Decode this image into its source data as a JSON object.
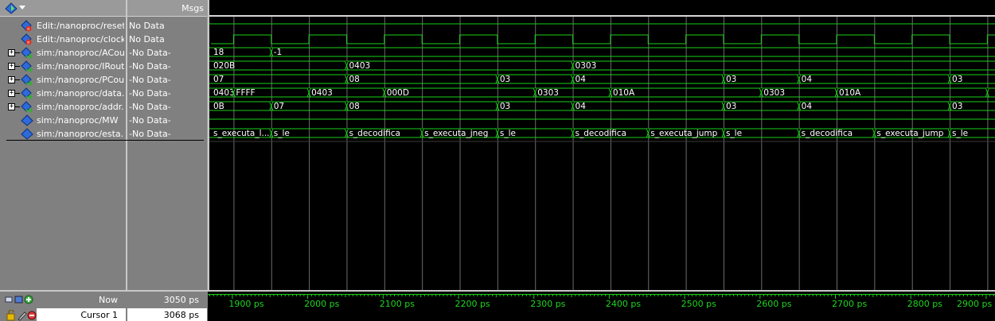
{
  "msgs_header": "Msgs",
  "signals": [
    {
      "name": "Edit:/nanoproc/reset",
      "value": "No Data",
      "kind": "bit",
      "expandable": false
    },
    {
      "name": "Edit:/nanoproc/clock",
      "value": "No Data",
      "kind": "bit",
      "expandable": false
    },
    {
      "name": "sim:/nanoproc/ACout",
      "value": "-No Data-",
      "kind": "bus",
      "expandable": true
    },
    {
      "name": "sim:/nanoproc/IRout",
      "value": "-No Data-",
      "kind": "bus",
      "expandable": true
    },
    {
      "name": "sim:/nanoproc/PCout",
      "value": "-No Data-",
      "kind": "bus",
      "expandable": true
    },
    {
      "name": "sim:/nanoproc/data...",
      "value": "-No Data-",
      "kind": "bus",
      "expandable": true
    },
    {
      "name": "sim:/nanoproc/addr...",
      "value": "-No Data-",
      "kind": "bus",
      "expandable": true
    },
    {
      "name": "sim:/nanoproc/MW",
      "value": "-No Data-",
      "kind": "sim",
      "expandable": false
    },
    {
      "name": "sim:/nanoproc/esta...",
      "value": "-No Data-",
      "kind": "sim",
      "expandable": false
    }
  ],
  "waves": {
    "time_start": 1870,
    "time_end": 2910,
    "clock_half_period": 25,
    "clock_first_edge": 1900,
    "buses": [
      {
        "row": 2,
        "segments": [
          {
            "t": 1870,
            "label": "18"
          },
          {
            "t": 1950,
            "label": "-1"
          }
        ]
      },
      {
        "row": 3,
        "segments": [
          {
            "t": 1870,
            "label": "020B"
          },
          {
            "t": 2050,
            "label": "0403"
          },
          {
            "t": 2350,
            "label": "0303"
          }
        ]
      },
      {
        "row": 4,
        "segments": [
          {
            "t": 1870,
            "label": "07"
          },
          {
            "t": 2050,
            "label": "08"
          },
          {
            "t": 2250,
            "label": "03"
          },
          {
            "t": 2350,
            "label": "04"
          },
          {
            "t": 2550,
            "label": "03"
          },
          {
            "t": 2650,
            "label": "04"
          },
          {
            "t": 2850,
            "label": "03"
          }
        ]
      },
      {
        "row": 5,
        "segments": [
          {
            "t": 1870,
            "label": "0403"
          },
          {
            "t": 1900,
            "label": "FFFF"
          },
          {
            "t": 2000,
            "label": "0403"
          },
          {
            "t": 2100,
            "label": "000D"
          },
          {
            "t": 2300,
            "label": "0303"
          },
          {
            "t": 2400,
            "label": "010A"
          },
          {
            "t": 2600,
            "label": "0303"
          },
          {
            "t": 2700,
            "label": "010A"
          },
          {
            "t": 2900,
            "label": ""
          }
        ]
      },
      {
        "row": 6,
        "segments": [
          {
            "t": 1870,
            "label": "0B"
          },
          {
            "t": 1950,
            "label": "07"
          },
          {
            "t": 2050,
            "label": "08"
          },
          {
            "t": 2250,
            "label": "03"
          },
          {
            "t": 2350,
            "label": "04"
          },
          {
            "t": 2550,
            "label": "03"
          },
          {
            "t": 2650,
            "label": "04"
          },
          {
            "t": 2850,
            "label": "03"
          }
        ]
      },
      {
        "row": 8,
        "segments": [
          {
            "t": 1870,
            "label": "s_executa_l..."
          },
          {
            "t": 1950,
            "label": "s_le"
          },
          {
            "t": 2050,
            "label": "s_decodifica"
          },
          {
            "t": 2150,
            "label": "s_executa_jneg"
          },
          {
            "t": 2250,
            "label": "s_le"
          },
          {
            "t": 2350,
            "label": "s_decodifica"
          },
          {
            "t": 2450,
            "label": "s_executa_jump"
          },
          {
            "t": 2550,
            "label": "s_le"
          },
          {
            "t": 2650,
            "label": "s_decodifica"
          },
          {
            "t": 2750,
            "label": "s_executa_jump"
          },
          {
            "t": 2850,
            "label": "s_le"
          }
        ]
      }
    ],
    "colors": {
      "wave": "#19d019",
      "background": "#000000",
      "gridline": "#6b6b6b"
    }
  },
  "toolbar": {
    "now_label": "Now",
    "now_value": "3050 ps",
    "cursor_label": "Cursor 1",
    "cursor_value": "3068 ps"
  },
  "time_axis": {
    "ticks": [
      "1900 ps",
      "2000 ps",
      "2100 ps",
      "2200 ps",
      "2300 ps",
      "2400 ps",
      "2500 ps",
      "2600 ps",
      "2700 ps",
      "2800 ps",
      "2900 ps"
    ],
    "tick_times": [
      1900,
      2000,
      2100,
      2200,
      2300,
      2400,
      2500,
      2600,
      2700,
      2800,
      2900
    ]
  },
  "icons": [
    "wave-diamond-icon",
    "bus-arrow-icon",
    "lock-icon",
    "pencil-icon",
    "delete-icon",
    "add-cursor-icon",
    "dropdown-arrow-icon"
  ]
}
